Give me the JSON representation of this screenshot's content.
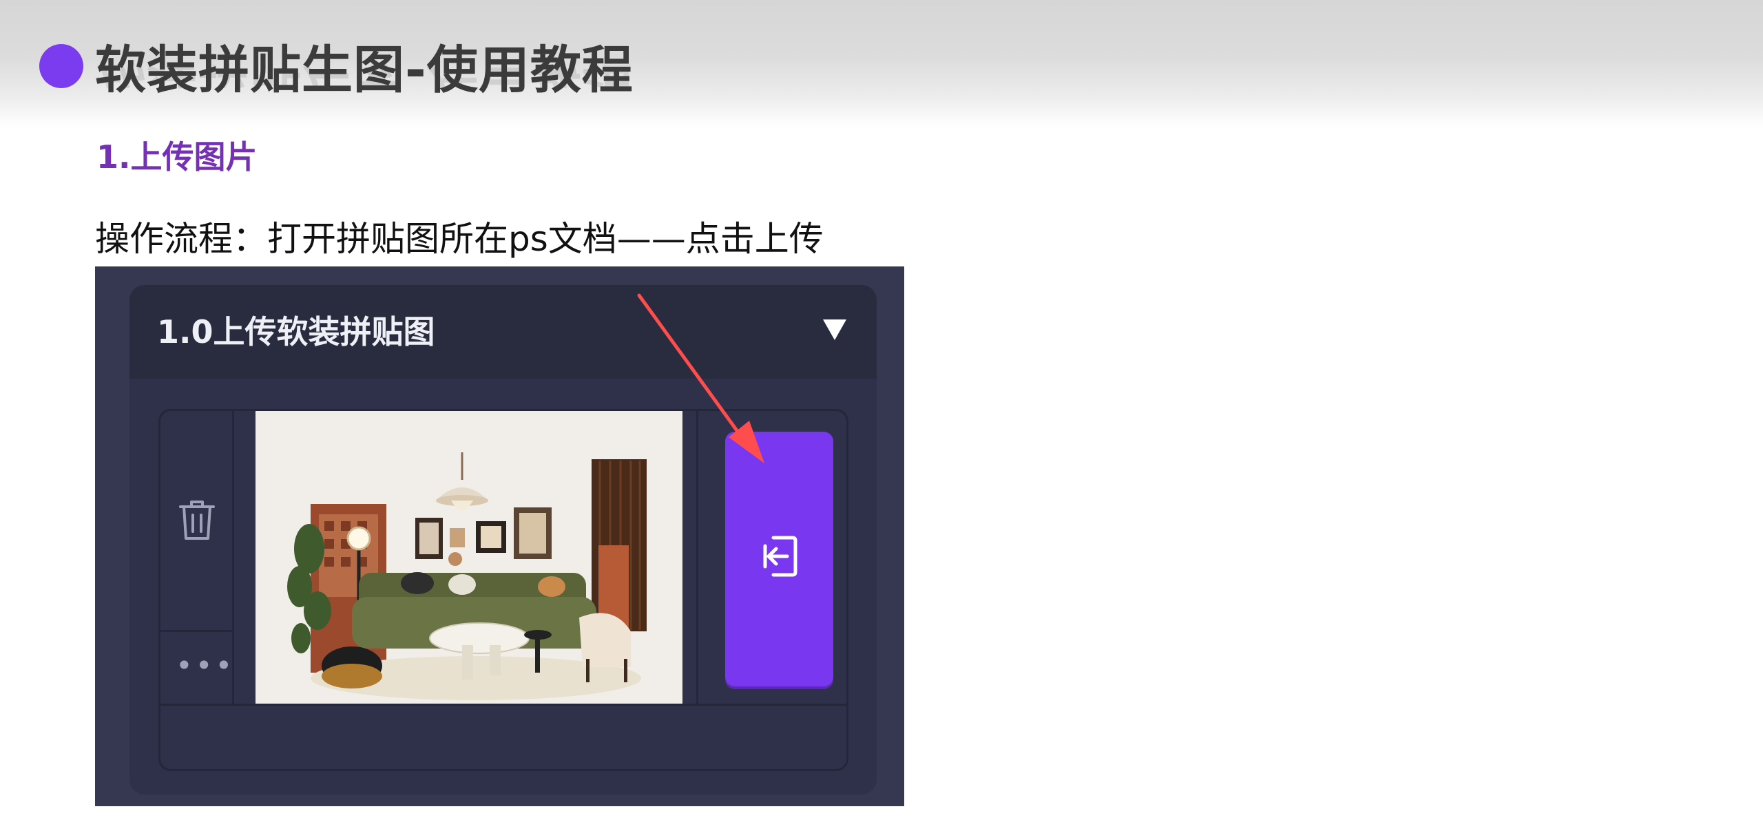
{
  "page": {
    "title": "软装拼贴生图-使用教程",
    "section_heading": "1.上传图片",
    "instruction": "操作流程：打开拼贴图所在ps文档——点击上传"
  },
  "screenshot_panel": {
    "card_title": "1.0上传软装拼贴图",
    "more_label": "•••",
    "icons": {
      "collapse": "triangle-down-icon",
      "delete": "trash-icon",
      "more": "ellipsis-icon",
      "upload": "import-icon",
      "pointer": "red-arrow-icon"
    }
  },
  "colors": {
    "accent_purple": "#7b3cf0",
    "heading_purple": "#7431b3",
    "panel_bg": "#363750",
    "header_bg": "#292b3e",
    "arrow_red": "#ff4d4d"
  }
}
